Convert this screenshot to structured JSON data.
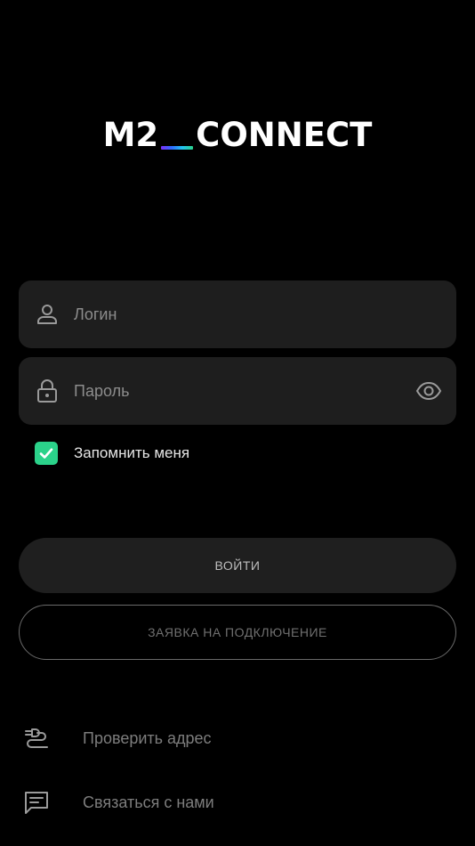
{
  "logo": {
    "left": "M2",
    "right": "CONNECT"
  },
  "login_field": {
    "placeholder": "Логин",
    "value": "",
    "icon": "user-icon"
  },
  "password_field": {
    "placeholder": "Пароль",
    "value": "",
    "icon": "lock-icon",
    "toggle_icon": "eye-icon"
  },
  "remember": {
    "label": "Запомнить меня",
    "checked": true
  },
  "buttons": {
    "login": "ВОЙТИ",
    "apply": "ЗАЯВКА НА ПОДКЛЮЧЕНИЕ"
  },
  "links": [
    {
      "label": "Проверить адрес",
      "icon": "address-check-icon"
    },
    {
      "label": "Связаться с нами",
      "icon": "chat-icon"
    }
  ],
  "colors": {
    "background": "#000000",
    "field_bg": "#1e1e1e",
    "checkbox": "#2bd28a",
    "underscore_gradient": [
      "#7b2ff7",
      "#2f6bff",
      "#22c3f0",
      "#2bd28a"
    ]
  }
}
